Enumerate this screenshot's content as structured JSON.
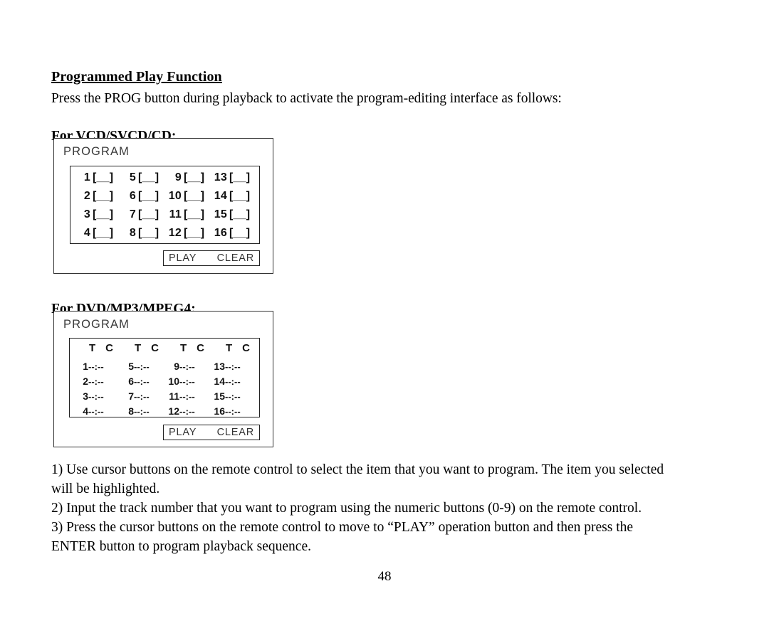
{
  "document": {
    "section_title": "Programmed Play Function",
    "intro": "Press the PROG button during playback to activate the program-editing interface as follows:",
    "page_number": "48"
  },
  "vcd_section": {
    "heading": "For VCD/SVCD/CD:",
    "panel": {
      "label": "PROGRAM",
      "rows": [
        [
          {
            "number": "1",
            "slot": "[__]"
          },
          {
            "number": "5",
            "slot": "[__]"
          },
          {
            "number": "9",
            "slot": "[__]"
          },
          {
            "number": "13",
            "slot": "[__]"
          }
        ],
        [
          {
            "number": "2",
            "slot": "[__]"
          },
          {
            "number": "6",
            "slot": "[__]"
          },
          {
            "number": "10",
            "slot": "[__]"
          },
          {
            "number": "14",
            "slot": "[__]"
          }
        ],
        [
          {
            "number": "3",
            "slot": "[__]"
          },
          {
            "number": "7",
            "slot": "[__]"
          },
          {
            "number": "11",
            "slot": "[__]"
          },
          {
            "number": "15",
            "slot": "[__]"
          }
        ],
        [
          {
            "number": "4",
            "slot": "[__]"
          },
          {
            "number": "8",
            "slot": "[__]"
          },
          {
            "number": "12",
            "slot": "[__]"
          },
          {
            "number": "16",
            "slot": "[__]"
          }
        ]
      ],
      "play_label": "PLAY",
      "clear_label": "CLEAR"
    }
  },
  "dvd_section": {
    "heading": "For DVD/MP3/MPEG4:",
    "panel": {
      "label": "PROGRAM",
      "column_headers": [
        {
          "t": "T",
          "c": "C"
        },
        {
          "t": "T",
          "c": "C"
        },
        {
          "t": "T",
          "c": "C"
        },
        {
          "t": "T",
          "c": "C"
        }
      ],
      "rows": [
        [
          {
            "number": "1",
            "time": "--:--"
          },
          {
            "number": "5",
            "time": "--:--"
          },
          {
            "number": "9",
            "time": "--:--"
          },
          {
            "number": "13",
            "time": "--:--"
          }
        ],
        [
          {
            "number": "2",
            "time": "--:--"
          },
          {
            "number": "6",
            "time": "--:--"
          },
          {
            "number": "10",
            "time": "--:--"
          },
          {
            "number": "14",
            "time": "--:--"
          }
        ],
        [
          {
            "number": "3",
            "time": "--:--"
          },
          {
            "number": "7",
            "time": "--:--"
          },
          {
            "number": "11",
            "time": "--:--"
          },
          {
            "number": "15",
            "time": "--:--"
          }
        ],
        [
          {
            "number": "4",
            "time": "--:--"
          },
          {
            "number": "8",
            "time": "--:--"
          },
          {
            "number": "12",
            "time": "--:--"
          },
          {
            "number": "16",
            "time": "--:--"
          }
        ]
      ],
      "play_label": "PLAY",
      "clear_label": "CLEAR"
    }
  },
  "instructions": {
    "item1_line1": "1) Use cursor buttons on the remote control to select the item that you want to program. The item you selected",
    "item1_line2": "will be highlighted.",
    "item2": "2) Input the track number that you want to program using the numeric buttons (0-9) on the remote control.",
    "item3_line1": "3) Press the cursor buttons on the remote control to move to “PLAY” operation button and then press the",
    "item3_line2": "ENTER button to program playback sequence."
  }
}
